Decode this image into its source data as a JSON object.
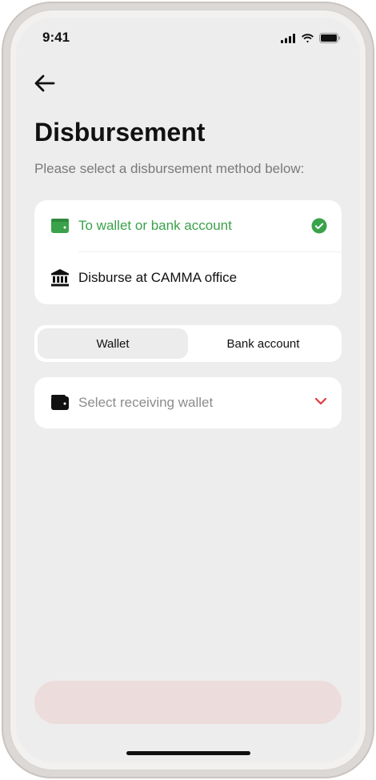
{
  "status_bar": {
    "time": "9:41"
  },
  "header": {
    "title": "Disbursement",
    "subtitle": "Please select a disbursement method below:"
  },
  "methods": [
    {
      "label": "To wallet or bank account",
      "icon": "wallet-card-icon",
      "selected": true
    },
    {
      "label": "Disburse at CAMMA office",
      "icon": "bank-building-icon",
      "selected": false
    }
  ],
  "tabs": [
    {
      "label": "Wallet",
      "active": true
    },
    {
      "label": "Bank account",
      "active": false
    }
  ],
  "wallet_select": {
    "placeholder": "Select receiving wallet",
    "icon": "wallet-icon"
  },
  "colors": {
    "accent_green": "#3aa24a",
    "accent_red": "#e03b3b",
    "disabled_button": "#ecdcdb",
    "background": "#ededed"
  },
  "continue_button": {
    "label": ""
  }
}
